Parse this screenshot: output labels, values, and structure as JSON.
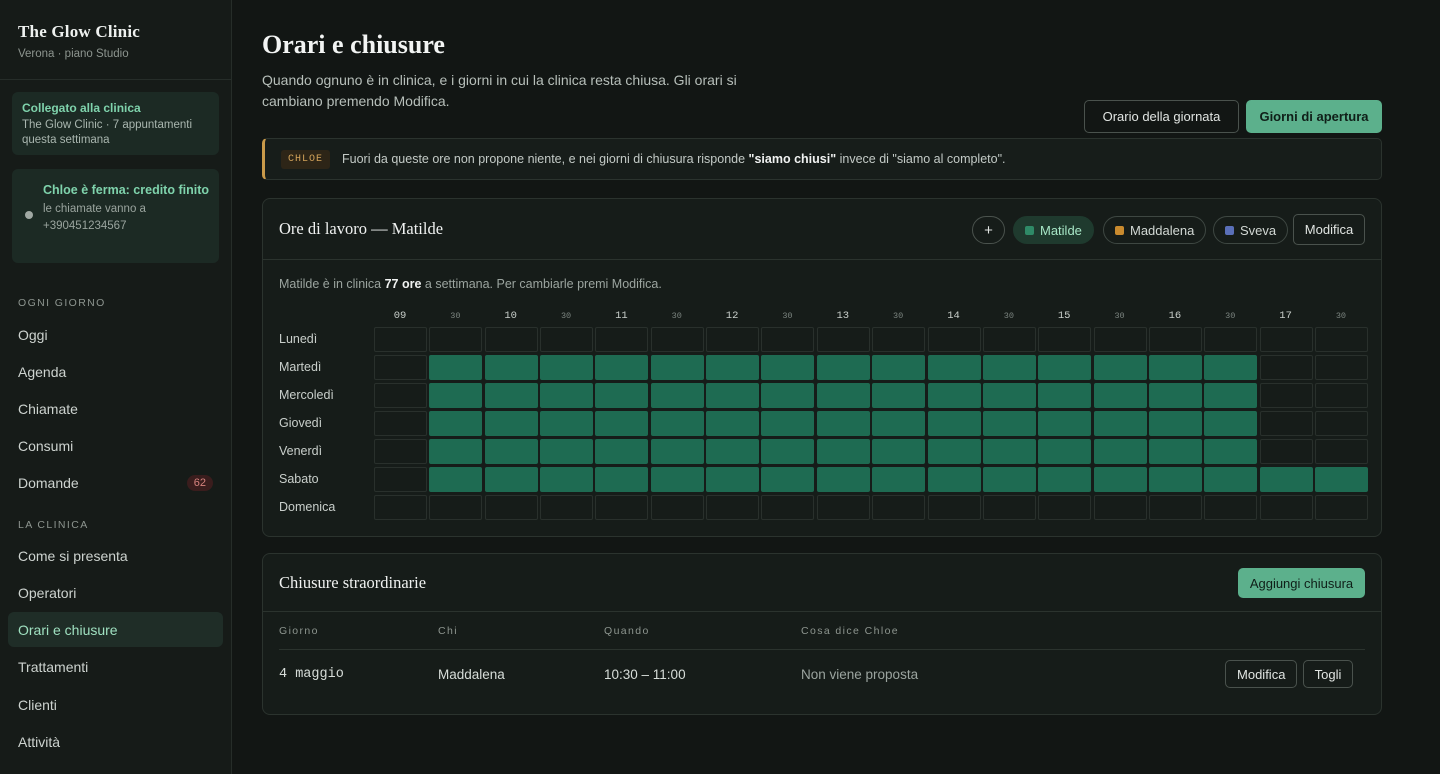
{
  "sidebar": {
    "brand_title": "The Glow Clinic",
    "brand_sub": "Verona · piano Studio",
    "connected": {
      "title": "Collegato alla clinica",
      "detail": "The Glow Clinic · 7 appuntamenti questa settimana"
    },
    "stopped": {
      "title": "Chloe è ferma: credito finito",
      "detail": "le chiamate vanno a +390451234567"
    },
    "sections": [
      {
        "label": "Ogni giorno",
        "items": [
          "Oggi",
          "Agenda",
          "Chiamate",
          "Consumi",
          "Domande"
        ]
      },
      {
        "label": "La clinica",
        "items": [
          "Come si presenta",
          "Operatori",
          "Orari e chiusure",
          "Trattamenti",
          "Clienti",
          "Attività"
        ]
      }
    ],
    "domande_badge": "62",
    "active_item": "Orari e chiusure"
  },
  "header": {
    "title": "Orari e chiusure",
    "description": "Quando ognuno è in clinica, e i giorni in cui la clinica resta chiusa. Gli orari si cambiano premendo Modifica.",
    "btn_day_schedule": "Orario della giornata",
    "btn_opening_days": "Giorni di apertura"
  },
  "notice": {
    "tag": "CHLOE",
    "text_before": "Fuori da queste ore non propone niente, e nei giorni di chiusura risponde ",
    "text_bold": "\"siamo chiusi\"",
    "text_after": " invece di \"siamo al completo\"."
  },
  "hours_panel": {
    "title": "Ore di lavoro — Matilde",
    "add_label": "+",
    "operators": [
      {
        "name": "Matilde",
        "color": "#2f8a67",
        "active": true
      },
      {
        "name": "Maddalena",
        "color": "#c98a2e",
        "active": false
      },
      {
        "name": "Sveva",
        "color": "#5a6fb8",
        "active": false
      }
    ],
    "edit_label": "Modifica",
    "info_before": "Matilde è in clinica ",
    "info_bold": "77 ore",
    "info_after": " a settimana. Per cambiarle premi Modifica.",
    "time_labels": [
      "09",
      "30",
      "10",
      "30",
      "11",
      "30",
      "12",
      "30",
      "13",
      "30",
      "14",
      "30",
      "15",
      "30",
      "16",
      "30",
      "17",
      "30"
    ],
    "days": [
      {
        "name": "Lunedì",
        "slots": [
          0,
          0,
          0,
          0,
          0,
          0,
          0,
          0,
          0,
          0,
          0,
          0,
          0,
          0,
          0,
          0,
          0,
          0
        ]
      },
      {
        "name": "Martedì",
        "slots": [
          0,
          1,
          1,
          1,
          1,
          1,
          1,
          1,
          1,
          1,
          1,
          1,
          1,
          1,
          1,
          1,
          0,
          0
        ]
      },
      {
        "name": "Mercoledì",
        "slots": [
          0,
          1,
          1,
          1,
          1,
          1,
          1,
          1,
          1,
          1,
          1,
          1,
          1,
          1,
          1,
          1,
          0,
          0
        ]
      },
      {
        "name": "Giovedì",
        "slots": [
          0,
          1,
          1,
          1,
          1,
          1,
          1,
          1,
          1,
          1,
          1,
          1,
          1,
          1,
          1,
          1,
          0,
          0
        ]
      },
      {
        "name": "Venerdì",
        "slots": [
          0,
          1,
          1,
          1,
          1,
          1,
          1,
          1,
          1,
          1,
          1,
          1,
          1,
          1,
          1,
          1,
          0,
          0
        ]
      },
      {
        "name": "Sabato",
        "slots": [
          0,
          1,
          1,
          1,
          1,
          1,
          1,
          1,
          1,
          1,
          1,
          1,
          1,
          1,
          1,
          1,
          1,
          1
        ]
      },
      {
        "name": "Domenica",
        "slots": [
          0,
          0,
          0,
          0,
          0,
          0,
          0,
          0,
          0,
          0,
          0,
          0,
          0,
          0,
          0,
          0,
          0,
          0
        ]
      }
    ]
  },
  "closures_panel": {
    "title": "Chiusure straordinarie",
    "add_label": "Aggiungi chiusura",
    "columns": [
      "Giorno",
      "Chi",
      "Quando",
      "Cosa dice Chloe"
    ],
    "rows": [
      {
        "day": "4 maggio",
        "who": "Maddalena",
        "when": "10:30 – 11:00",
        "chloe": "Non viene proposta",
        "edit": "Modifica",
        "remove": "Togli"
      }
    ]
  },
  "colors": {
    "accent": "#5cb08c",
    "slot_on": "#1e6b52",
    "warning": "#c99a4a"
  }
}
